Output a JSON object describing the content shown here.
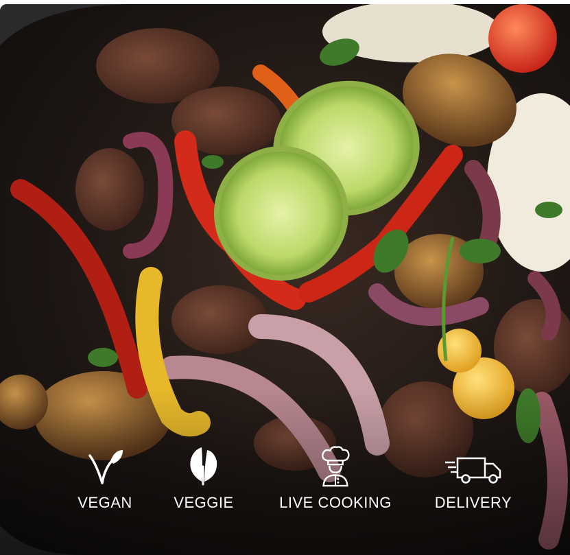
{
  "features": [
    {
      "label": "VEGAN",
      "icon": "vegan-sprout-icon"
    },
    {
      "label": "VEGGIE",
      "icon": "veggie-leaf-icon"
    },
    {
      "label": "LIVE COOKING",
      "icon": "chef-icon"
    },
    {
      "label": "DELIVERY",
      "icon": "delivery-truck-icon"
    }
  ],
  "colors": {
    "label_text": "#ffffff",
    "pan_dark": "#1a1614",
    "red_pepper": "#c8261a",
    "lime": "#b8d86a",
    "onion": "#7a3a4a",
    "rice": "#f1ebde"
  }
}
